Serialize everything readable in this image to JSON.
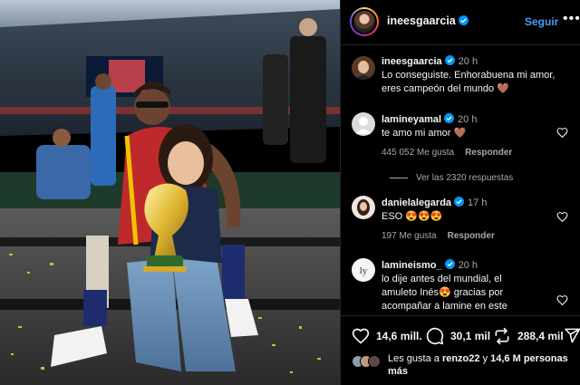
{
  "post": {
    "username": "ineesgaarcia",
    "follow_label": "Seguir",
    "more_label": "•••"
  },
  "caption": {
    "username": "ineesgaarcia",
    "time": "20 h",
    "line1": "Lo conseguiste. Enhorabuena mi amor,",
    "line2": "eres campeón del mundo 🤎"
  },
  "comments": [
    {
      "username": "lamineyamal",
      "time": "20 h",
      "text": "te amo mi amor 🤎",
      "likes": "445 052 Me gusta",
      "reply": "Responder"
    },
    {
      "username": "danielalegarda",
      "time": "17 h",
      "text": "ESO 😍😍😍",
      "likes": "197 Me gusta",
      "reply": "Responder"
    },
    {
      "username": "lamineismo_",
      "time": "20 h",
      "line1": "lo dije antes del mundial, el",
      "line2": "amuleto Inés😍 gracias por",
      "line3": "acompañar a lamine en este"
    }
  ],
  "view_replies": "Ver las 2320 respuestas",
  "actions": {
    "likes": "14,6 mill.",
    "comments": "30,1 mil",
    "shares": "288,4 mil"
  },
  "liked_by": {
    "prefix": "Les gusta a",
    "user": "renzo22",
    "connector": "y",
    "count": "14,6 M personas",
    "suffix": "más"
  }
}
